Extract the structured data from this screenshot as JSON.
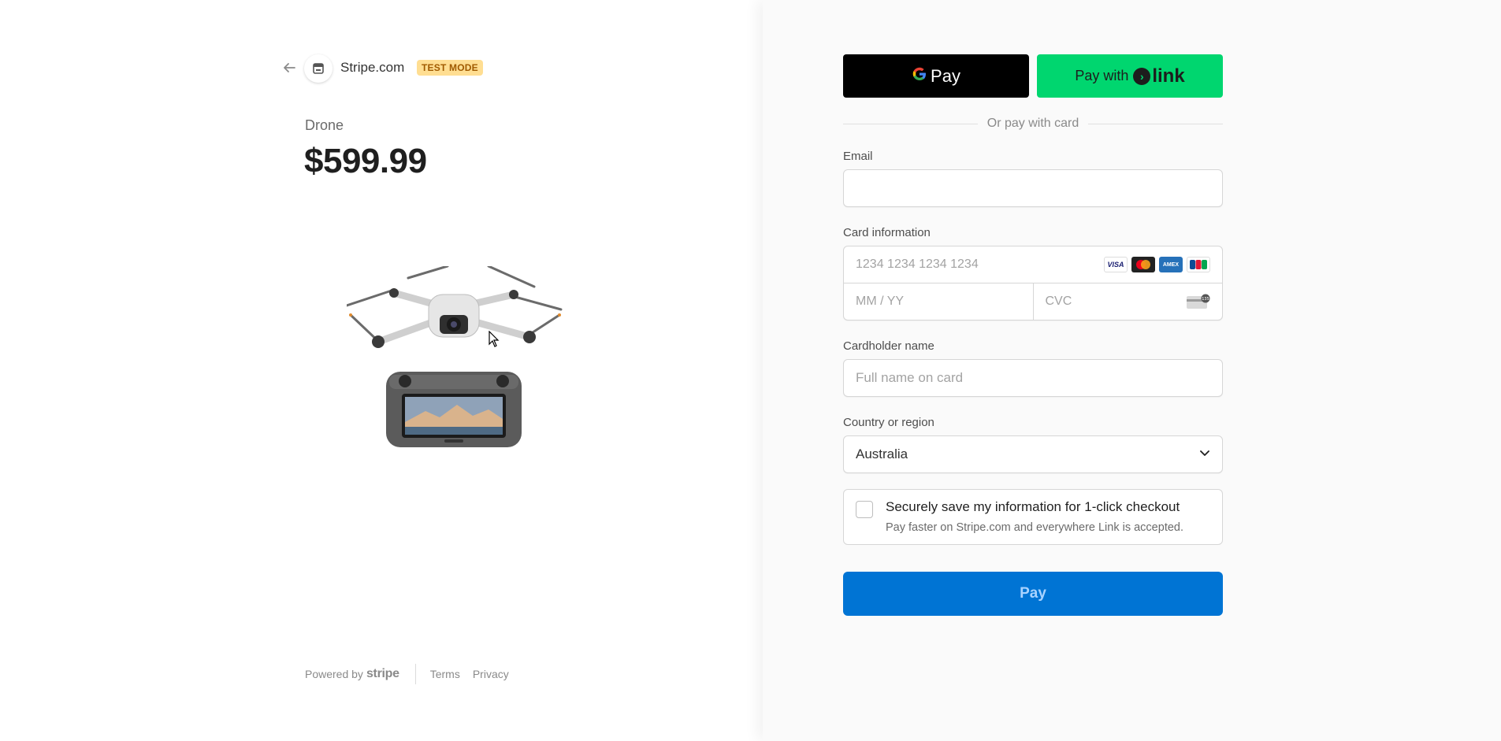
{
  "merchant": {
    "name": "Stripe.com",
    "badge": "TEST MODE"
  },
  "product": {
    "name": "Drone",
    "price": "$599.99"
  },
  "footer": {
    "powered_by": "Powered by",
    "brand": "stripe",
    "terms": "Terms",
    "privacy": "Privacy"
  },
  "wallets": {
    "gpay_label": "Pay",
    "link_prefix": "Pay with",
    "link_word": "link"
  },
  "divider_text": "Or pay with card",
  "form": {
    "email_label": "Email",
    "email_value": "",
    "card_label": "Card information",
    "card_number_placeholder": "1234 1234 1234 1234",
    "expiry_placeholder": "MM / YY",
    "cvc_placeholder": "CVC",
    "card_brands": [
      "VISA",
      "Mastercard",
      "AMEX",
      "JCB"
    ],
    "cardholder_label": "Cardholder name",
    "cardholder_placeholder": "Full name on card",
    "country_label": "Country or region",
    "country_value": "Australia",
    "save_title": "Securely save my information for 1-click checkout",
    "save_subtitle": "Pay faster on Stripe.com and everywhere Link is accepted.",
    "save_checked": false,
    "pay_label": "Pay"
  },
  "colors": {
    "pay_button": "#0074d4",
    "link_button": "#00d66f",
    "gpay_button": "#000000",
    "test_badge_bg": "#ffde92",
    "test_badge_fg": "#a05a00"
  }
}
